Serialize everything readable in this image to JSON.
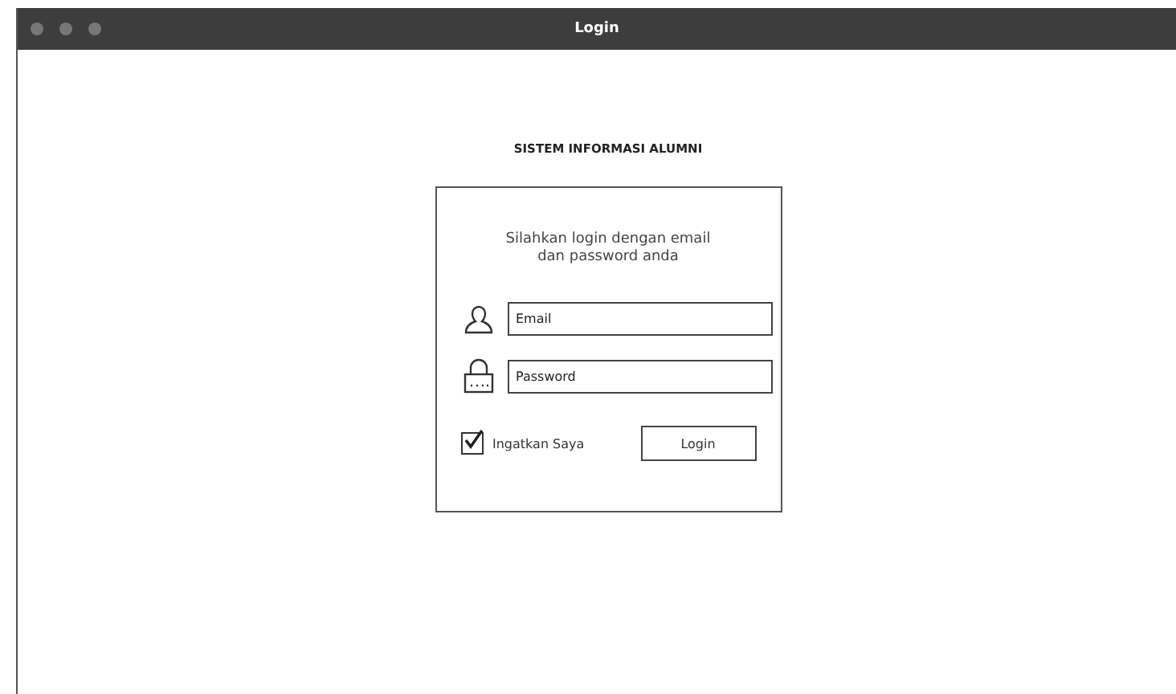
{
  "window": {
    "title": "Login"
  },
  "heading": "SISTEM INFORMASI ALUMNI",
  "login_form": {
    "message": "Silahkan login dengan email dan password anda",
    "fields": [
      {
        "kind": "email",
        "placeholder": "Email"
      },
      {
        "kind": "password",
        "placeholder": "Password"
      }
    ],
    "remember": {
      "label": "Ingatkan Saya",
      "checked": true
    },
    "button": "Login"
  }
}
